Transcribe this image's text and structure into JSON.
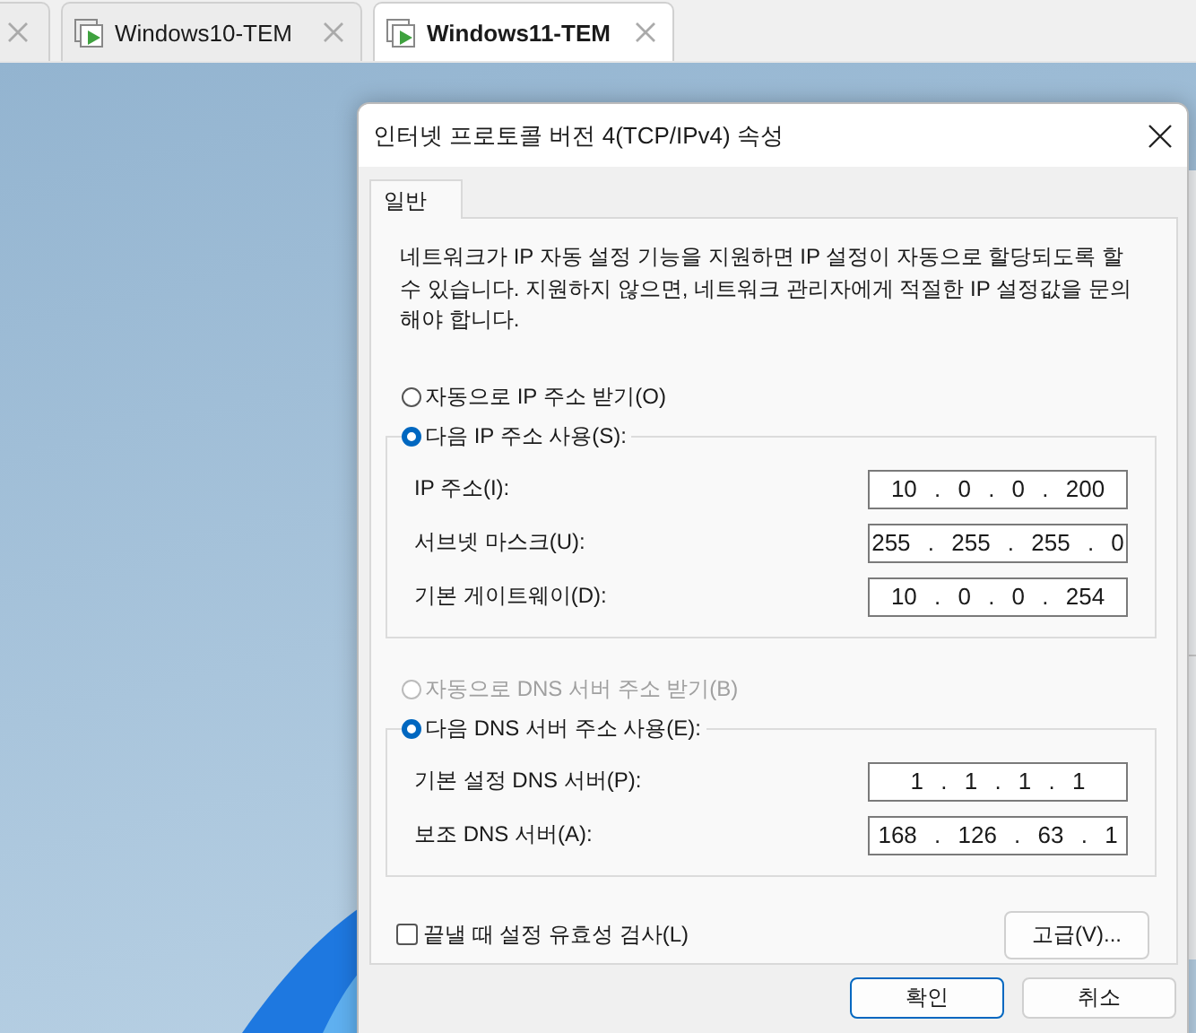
{
  "tabs": [
    {
      "selected": false
    },
    {
      "label": "Windows10-TEM",
      "selected": false
    },
    {
      "label": "Windows11-TEM",
      "selected": true
    }
  ],
  "dialog": {
    "title": "인터넷 프로토콜 버전 4(TCP/IPv4) 속성",
    "tabs": [
      {
        "label": "일반",
        "selected": true
      }
    ],
    "description": "네트워크가 IP 자동 설정 기능을 지원하면 IP 설정이 자동으로 할당되도록 할 수 있습니다. 지원하지 않으면, 네트워크 관리자에게 적절한 IP 설정값을 문의해야 합니다.",
    "groups": [
      {
        "auto_option": {
          "label": "자동으로 IP 주소 받기(O)",
          "selected": false,
          "disabled": false
        },
        "manual_option": {
          "label": "다음 IP 주소 사용(S):",
          "selected": true,
          "disabled": false
        },
        "fields": [
          {
            "label": "IP 주소(I):",
            "value": "10 . 0 . 0 . 200"
          },
          {
            "label": "서브넷 마스크(U):",
            "value": "255 . 255 . 255 . 0"
          },
          {
            "label": "기본 게이트웨이(D):",
            "value": "10 . 0 . 0 . 254"
          }
        ]
      },
      {
        "auto_option": {
          "label": "자동으로 DNS 서버 주소 받기(B)",
          "selected": false,
          "disabled": true
        },
        "manual_option": {
          "label": "다음 DNS 서버 주소 사용(E):",
          "selected": true,
          "disabled": false
        },
        "fields": [
          {
            "label": "기본 설정 DNS 서버(P):",
            "value": "1 . 1 . 1 . 1"
          },
          {
            "label": "보조 DNS 서버(A):",
            "value": "168 . 126 . 63 . 1"
          }
        ]
      }
    ],
    "validate": {
      "label": "끝낼 때 설정 유효성 검사(L)",
      "checked": false
    },
    "advanced_button": "고급(V)...",
    "buttons": [
      {
        "label": "확인",
        "kind": "default"
      },
      {
        "label": "취소",
        "kind": "normal"
      }
    ]
  }
}
